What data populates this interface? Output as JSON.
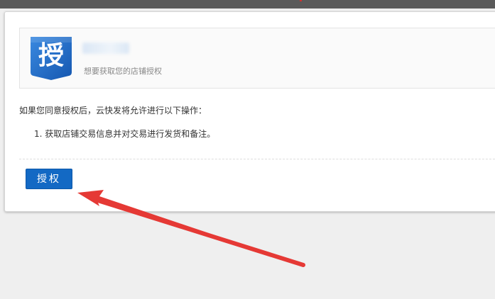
{
  "logo": {
    "char": "授"
  },
  "app": {
    "description": "想要获取您的店铺授权"
  },
  "consent": {
    "intro": "如果您同意授权后，云快发将允许进行以下操作：",
    "permissions": [
      "1. 获取店铺交易信息并对交易进行发货和备注。"
    ]
  },
  "actions": {
    "authorize_label": "授权"
  },
  "colors": {
    "button": "#1369c4",
    "logo_blue": "#1f6fd0",
    "arrow": "#e53935"
  },
  "icons": {
    "annotation": "red-arrow-icon"
  }
}
